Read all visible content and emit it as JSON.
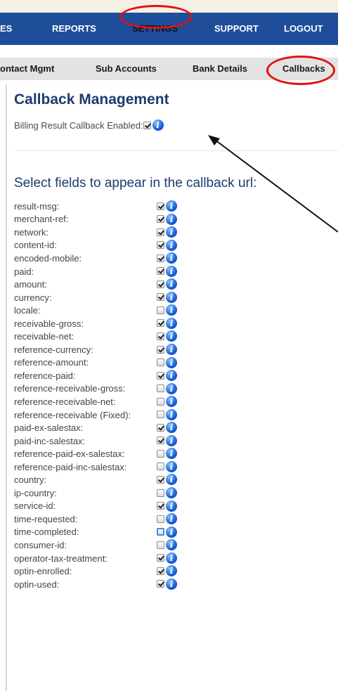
{
  "nav": {
    "items": [
      {
        "label": "ES"
      },
      {
        "label": "REPORTS"
      },
      {
        "label": "SETTINGS"
      },
      {
        "label": "SUPPORT"
      },
      {
        "label": "LOGOUT"
      }
    ]
  },
  "subnav": {
    "items": [
      {
        "label": "ontact Mgmt"
      },
      {
        "label": "Sub Accounts"
      },
      {
        "label": "Bank Details"
      },
      {
        "label": "Callbacks"
      }
    ]
  },
  "page": {
    "title": "Callback Management",
    "billing_label": "Billing Result Callback Enabled:",
    "billing_checked": true,
    "fields_title": "Select fields to appear in the callback url:"
  },
  "info_glyph": "i",
  "annotation_color": "#e11111",
  "fields": [
    {
      "label": "result-msg:",
      "checked": true
    },
    {
      "label": "merchant-ref:",
      "checked": true
    },
    {
      "label": "network:",
      "checked": true
    },
    {
      "label": "content-id:",
      "checked": true
    },
    {
      "label": "encoded-mobile:",
      "checked": true
    },
    {
      "label": "paid:",
      "checked": true
    },
    {
      "label": "amount:",
      "checked": true
    },
    {
      "label": "currency:",
      "checked": true
    },
    {
      "label": "locale:",
      "checked": false
    },
    {
      "label": "receivable-gross:",
      "checked": true
    },
    {
      "label": "receivable-net:",
      "checked": true
    },
    {
      "label": "reference-currency:",
      "checked": true
    },
    {
      "label": "reference-amount:",
      "checked": false
    },
    {
      "label": "reference-paid:",
      "checked": true
    },
    {
      "label": "reference-receivable-gross:",
      "checked": false
    },
    {
      "label": "reference-receivable-net:",
      "checked": false
    },
    {
      "label": "reference-receivable (Fixed):",
      "checked": false
    },
    {
      "label": "paid-ex-salestax:",
      "checked": true
    },
    {
      "label": "paid-inc-salestax:",
      "checked": true
    },
    {
      "label": "reference-paid-ex-salestax:",
      "checked": false
    },
    {
      "label": "reference-paid-inc-salestax:",
      "checked": false
    },
    {
      "label": "country:",
      "checked": true
    },
    {
      "label": "ip-country:",
      "checked": false
    },
    {
      "label": "service-id:",
      "checked": true
    },
    {
      "label": "time-requested:",
      "checked": false
    },
    {
      "label": "time-completed:",
      "checked": false,
      "focused": true
    },
    {
      "label": "consumer-id:",
      "checked": false
    },
    {
      "label": "operator-tax-treatment:",
      "checked": true
    },
    {
      "label": "optin-enrolled:",
      "checked": true
    },
    {
      "label": "optin-used:",
      "checked": true
    }
  ]
}
